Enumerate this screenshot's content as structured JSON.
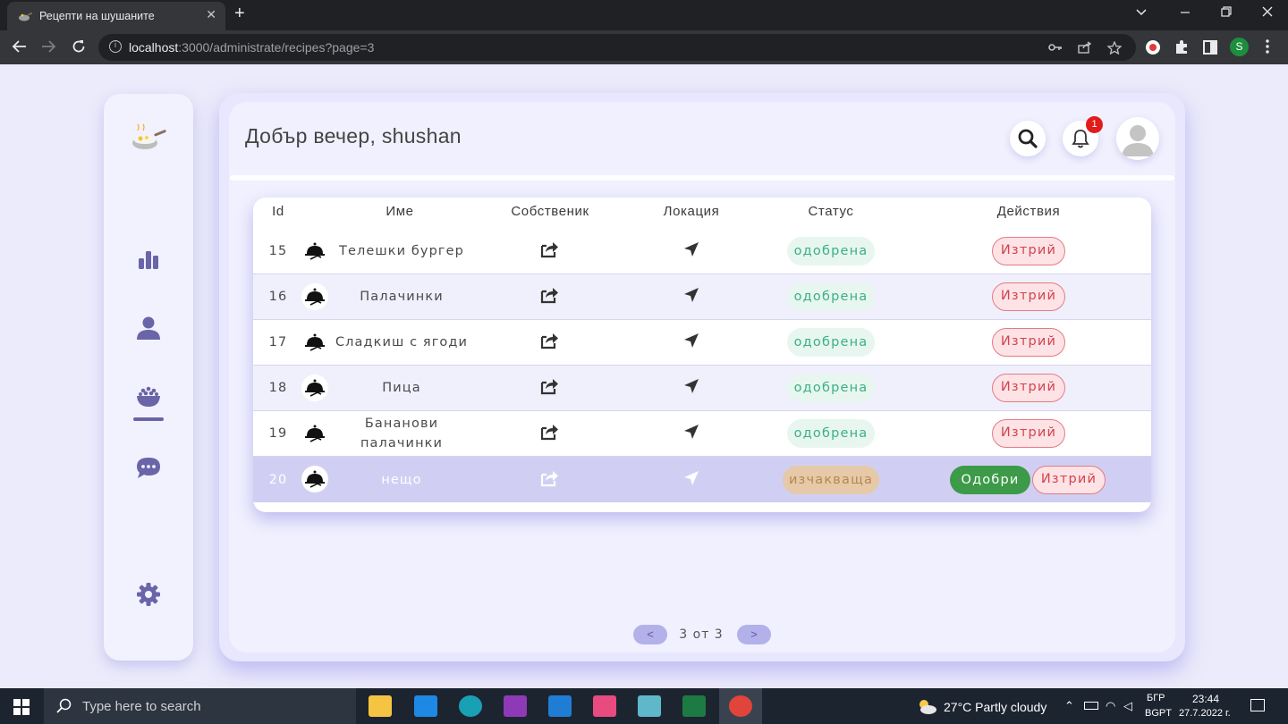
{
  "browser": {
    "tab_title": "Рецепти на шушаните",
    "url_host": "localhost",
    "url_rest": ":3000/administrate/recipes?page=3",
    "close_tab": "✕",
    "new_tab": "+"
  },
  "header": {
    "greeting": "Добър вечер, shushan",
    "notification_count": "1"
  },
  "table": {
    "columns": [
      "Id",
      "Име",
      "Собственик",
      "Локация",
      "Статус",
      "Действия"
    ],
    "rows": [
      {
        "id": "15",
        "name": "Телешки бургер",
        "status": "одобрена",
        "delete": "Изтрий"
      },
      {
        "id": "16",
        "name": "Палачинки",
        "status": "одобрена",
        "delete": "Изтрий"
      },
      {
        "id": "17",
        "name": "Сладкиш с ягоди",
        "status": "одобрена",
        "delete": "Изтрий"
      },
      {
        "id": "18",
        "name": "Пица",
        "status": "одобрена",
        "delete": "Изтрий"
      },
      {
        "id": "19",
        "name_line1": "Бананови",
        "name_line2": "палачинки",
        "status": "одобрена",
        "delete": "Изтрий"
      },
      {
        "id": "20",
        "name": "нещо",
        "status": "изчакваща",
        "approve": "Одобри",
        "delete": "Изтрий"
      }
    ]
  },
  "pagination": {
    "prev": "<",
    "next": ">",
    "label": "3 от 3"
  },
  "taskbar": {
    "search_placeholder": "Type here to search",
    "weather": "27°C  Partly cloudy",
    "lang_top": "БГР",
    "lang_bottom": "BGPT",
    "time": "23:44",
    "date": "27.7.2022 г."
  },
  "colors": {
    "accent": "#6a64a8",
    "approved": "#3ab087",
    "pending": "#b5884e",
    "delete": "#d3434f",
    "approve_button": "#3d9a48"
  }
}
